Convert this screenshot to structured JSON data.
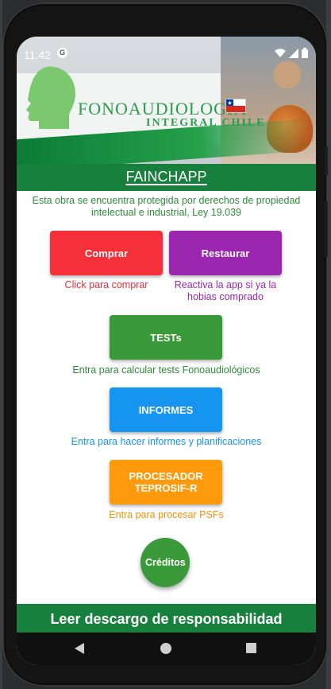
{
  "status_bar": {
    "time": "11:42"
  },
  "banner": {
    "line1": "FONOAUDIOLOGÍA",
    "line2": "INTEGRAL CHILE"
  },
  "header": {
    "title": "FAINCHAPP"
  },
  "notice": "Esta obra se encuentra protegida por derechos de propiedad intelectual e industrial, Ley 19.039",
  "buttons": {
    "comprar": {
      "label": "Comprar",
      "caption": "Click para comprar",
      "color": "#f5303a"
    },
    "restaurar": {
      "label": "Restaurar",
      "caption": "Reactiva la app si ya la hobias comprado",
      "color": "#9b27b0"
    },
    "tests": {
      "label": "TESTs",
      "caption": "Entra para calcular tests Fonoaudiológicos",
      "color": "#3a9a3a"
    },
    "informes": {
      "label": "INFORMES",
      "caption": "Entra para hacer informes y planificaciones",
      "color": "#1595f0"
    },
    "procesador": {
      "label": "PROCESADOR TEPROSIF-R",
      "caption": "Entra para procesar PSFs",
      "color": "#ff9a0d"
    },
    "creditos": {
      "label": "Créditos",
      "color": "#3a9a3a"
    }
  },
  "footer": {
    "label": "Leer descargo de responsabilidad"
  },
  "colors": {
    "app_green": "#16803c",
    "caption_green": "#2e8b3a"
  },
  "icons": [
    "wifi-icon",
    "signal-icon",
    "battery-icon",
    "back-icon",
    "home-icon",
    "recents-icon",
    "app-notification-icon"
  ]
}
